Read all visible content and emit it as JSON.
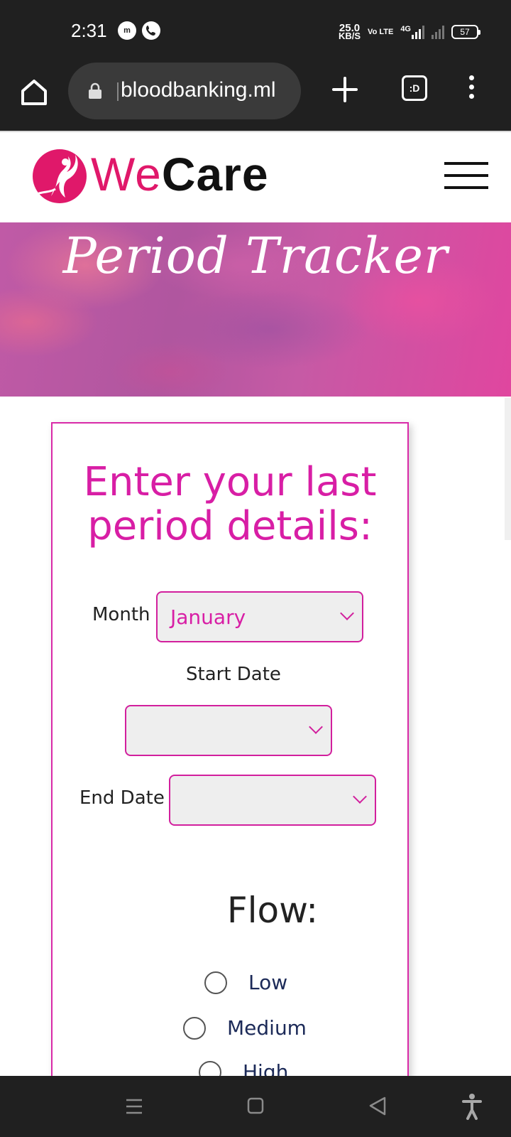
{
  "status_bar": {
    "time": "2:31",
    "notif_icons": [
      "messenger-icon",
      "phone-icon"
    ],
    "net_speed_value": "25.0",
    "net_speed_unit": "KB/S",
    "volte_label": "Vo LTE",
    "network_label": "4G",
    "battery_level": "57"
  },
  "browser": {
    "url": "bloodbanking.ml",
    "tabs_label": ":D"
  },
  "site": {
    "logo_we": "We",
    "logo_care": "Care",
    "brand_color": "#e0186a"
  },
  "hero": {
    "title": "Period Tracker"
  },
  "form": {
    "title_line1": "Enter your last",
    "title_line2": "period details:",
    "month_label": "Month",
    "month_value": "January",
    "start_date_label": "Start Date",
    "start_date_value": "",
    "end_date_label": "End Date",
    "end_date_value": "",
    "flow_title": "Flow:",
    "flow_options": [
      "Low",
      "Medium",
      "High"
    ],
    "accent_color": "#d81ea5"
  },
  "nav_bar": {
    "icons": [
      "recents-icon",
      "home-icon",
      "back-icon",
      "accessibility-icon"
    ]
  }
}
